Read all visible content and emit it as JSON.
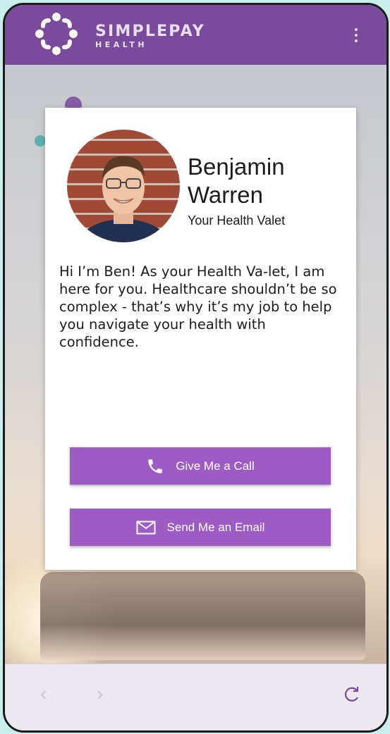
{
  "app": {
    "brand_name": "SIMPLEPAY",
    "brand_sub": "HEALTH"
  },
  "profile": {
    "name": "Benjamin Warren",
    "role": "Your Health Valet",
    "bio": "Hi I’m Ben! As your Health Va-let, I am here for you. Healthcare shouldn’t be so complex - that’s why it’s my job to help you navigate your health with confidence."
  },
  "actions": {
    "call_label": "Give Me a Call",
    "email_label": "Send Me an Email"
  },
  "nav": {
    "back": "‹",
    "forward": "›"
  },
  "colors": {
    "brand": "#7a4a9c",
    "button": "#9c5cc4",
    "teal": "#2aa7a0"
  },
  "icons": [
    "logo-icon",
    "kebab-menu-icon",
    "phone-icon",
    "mail-icon",
    "back-icon",
    "forward-icon",
    "refresh-icon"
  ]
}
